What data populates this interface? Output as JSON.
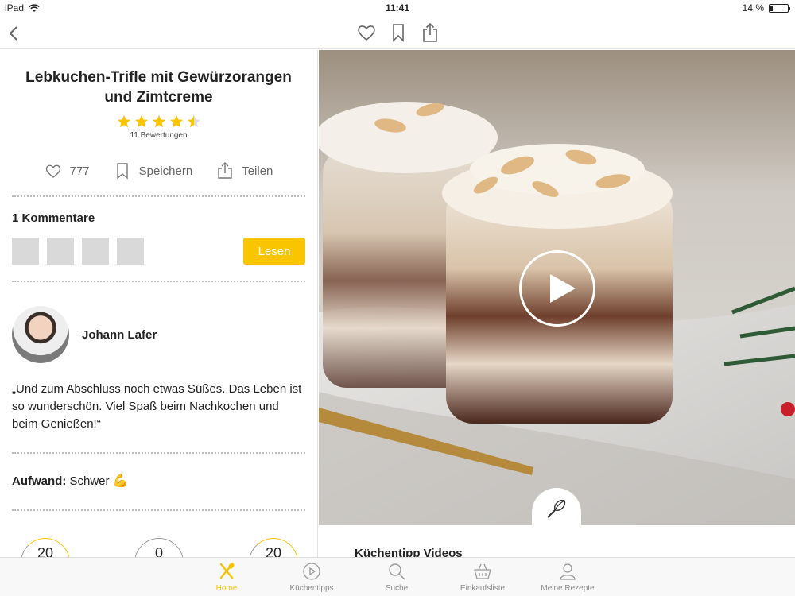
{
  "status": {
    "device": "iPad",
    "time": "11:41",
    "battery": "14 %",
    "battery_level": 0.14
  },
  "nav": {
    "back": "back",
    "icons": [
      "heart-icon",
      "bookmark-icon",
      "share-icon"
    ]
  },
  "recipe": {
    "title": "Lebkuchen-Trifle mit Gewürzorangen und Zimtcreme",
    "rating": 4.5,
    "rating_count": "11 Bewertungen",
    "likes": "777",
    "save_label": "Speichern",
    "share_label": "Teilen"
  },
  "comments": {
    "title": "1 Kommentare",
    "read_button": "Lesen"
  },
  "author": {
    "name": "Johann Lafer",
    "quote": "„Und zum Abschluss noch etwas Süßes. Das Leben ist so wunderschön. Viel Spaß beim Nachkochen und beim Genießen!“"
  },
  "effort": {
    "label": "Aufwand:",
    "value": "Schwer",
    "emoji": "💪"
  },
  "stats": [
    "20",
    "0",
    "20"
  ],
  "video": {
    "section_title": "Küchentipp Videos"
  },
  "accent": "#f9c500",
  "tabs": [
    {
      "label": "Home",
      "icon": "fork-spoon-icon",
      "active": true
    },
    {
      "label": "Küchentipps",
      "icon": "play-icon",
      "active": false
    },
    {
      "label": "Suche",
      "icon": "search-icon",
      "active": false
    },
    {
      "label": "Einkaufsliste",
      "icon": "basket-icon",
      "active": false
    },
    {
      "label": "Meine Rezepte",
      "icon": "person-icon",
      "active": false
    }
  ]
}
